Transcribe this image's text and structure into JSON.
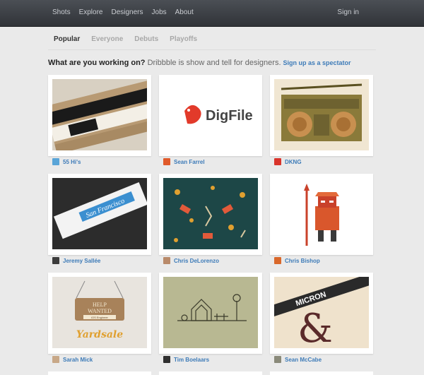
{
  "nav": {
    "items": [
      "Shots",
      "Explore",
      "Designers",
      "Jobs",
      "About"
    ],
    "signin": "Sign in"
  },
  "tabs": [
    "Popular",
    "Everyone",
    "Debuts",
    "Playoffs"
  ],
  "intro": {
    "question": "What are you working on?",
    "text": " Dribbble is show and tell for designers.",
    "signup": "Sign up as a spectator"
  },
  "shots": [
    {
      "player": "55 Hi's",
      "avatar_color": "#5aa5d8"
    },
    {
      "player": "Sean Farrel",
      "avatar_color": "#e05a2a",
      "logo": "DigFile"
    },
    {
      "player": "DKNG",
      "avatar_color": "#d9342b"
    },
    {
      "player": "Jeremy Sallée",
      "avatar_color": "#3c3c3c",
      "label_text": "San Francisco"
    },
    {
      "player": "Chris DeLorenzo",
      "avatar_color": "#b98a6a"
    },
    {
      "player": "Chris Bishop",
      "avatar_color": "#d9682b"
    },
    {
      "player": "Sarah Mick",
      "avatar_color": "#c8a888",
      "sign_text": [
        "HELP",
        "WANTED"
      ],
      "sign_sub": "iOS Engineer",
      "script": "Yardsale"
    },
    {
      "player": "Tim Boelaars",
      "avatar_color": "#2f2f2f"
    },
    {
      "player": "Sean McCabe",
      "avatar_color": "#8a8a7a",
      "pen_text": "MICRON"
    }
  ],
  "colors": {
    "link": "#3d7bb8",
    "nav_bg": "#3d4046",
    "page_bg": "#eaeaea"
  }
}
